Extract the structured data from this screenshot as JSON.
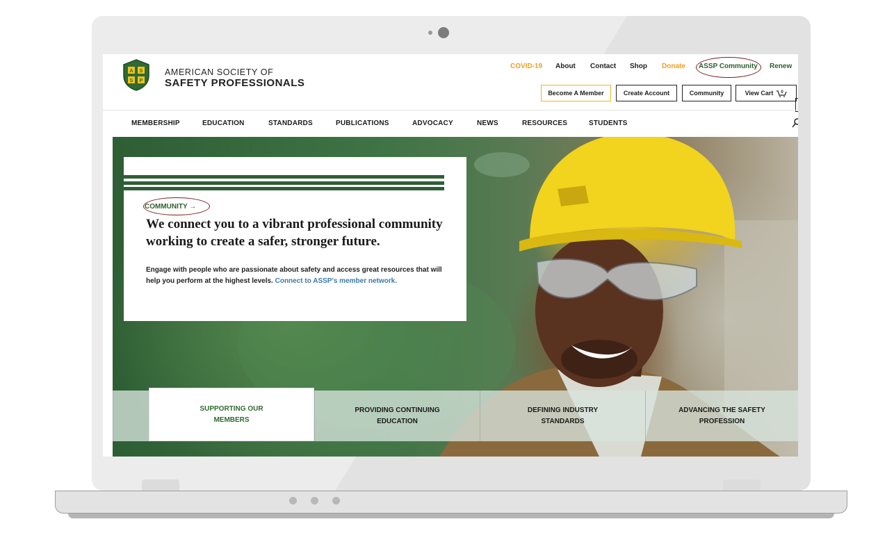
{
  "colors": {
    "brand_green": "#2f5e2f",
    "accent_orange": "#f0a020",
    "link_blue": "#3b79a8",
    "annotation_red": "#7a1f1f"
  },
  "org": {
    "line1": "AMERICAN SOCIETY OF",
    "line2": "SAFETY PROFESSIONALS",
    "logo_letters": [
      "A",
      "S",
      "S",
      "P"
    ]
  },
  "utility_nav": {
    "covid": "COVID-19",
    "about": "About",
    "contact": "Contact",
    "shop": "Shop",
    "donate": "Donate",
    "community": "ASSP Community",
    "renew": "Renew"
  },
  "buttons": {
    "member": "Become A Member",
    "create": "Create Account",
    "community": "Community",
    "cart": "View Cart",
    "cart_count": "0"
  },
  "main_nav": [
    "MEMBERSHIP",
    "EDUCATION",
    "STANDARDS",
    "PUBLICATIONS",
    "ADVOCACY",
    "NEWS",
    "RESOURCES",
    "STUDENTS"
  ],
  "hero": {
    "eyebrow": "COMMUNITY →",
    "headline": "We connect you to a vibrant professional community working to create a safer, stronger future.",
    "body": "Engage with people who are passionate about safety and access great resources that will help you perform at the highest levels.",
    "link": "Connect to ASSP's member network."
  },
  "pillars": [
    {
      "line1": "SUPPORTING OUR",
      "line2": "MEMBERS",
      "active": true
    },
    {
      "line1": "PROVIDING CONTINUING",
      "line2": "EDUCATION",
      "active": false
    },
    {
      "line1": "DEFINING INDUSTRY",
      "line2": "STANDARDS",
      "active": false
    },
    {
      "line1": "ADVANCING THE SAFETY",
      "line2": "PROFESSION",
      "active": false
    }
  ]
}
